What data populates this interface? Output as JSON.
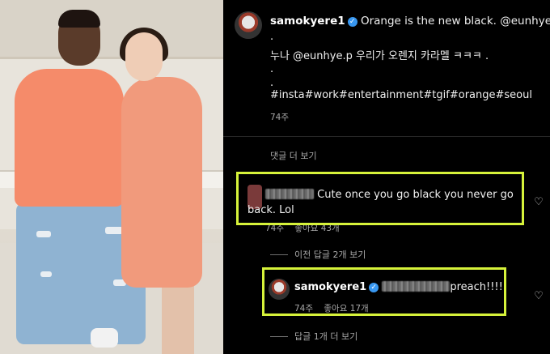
{
  "post": {
    "username": "samokyere1",
    "caption_line1": "Orange is the new black. @eunhye.p .",
    "dot1": ".",
    "caption_line2": "누나 @eunhye.p  우리가 오렌지 카라멜 ㅋㅋㅋ .",
    "dot2": ".",
    "dot3": ".",
    "hashtags": "#insta#work#entertainment#tgif#orange#seoul",
    "time": "74주"
  },
  "view_more_comments": "댓글 더 보기",
  "comment1": {
    "text_line1": "Cute once you go black you never go",
    "text_line2": "back. Lol",
    "time": "74주",
    "likes": "좋아요 43개"
  },
  "view_previous_replies": "이전 답글 2개 보기",
  "reply": {
    "username": "samokyere1",
    "text": "preach!!!!!",
    "time": "74주",
    "likes": "좋아요 17개"
  },
  "view_more_replies": "답글 1개 더 보기",
  "colors": {
    "highlight_box": "#d6f23a",
    "verified": "#3897f0",
    "background": "#000000"
  }
}
